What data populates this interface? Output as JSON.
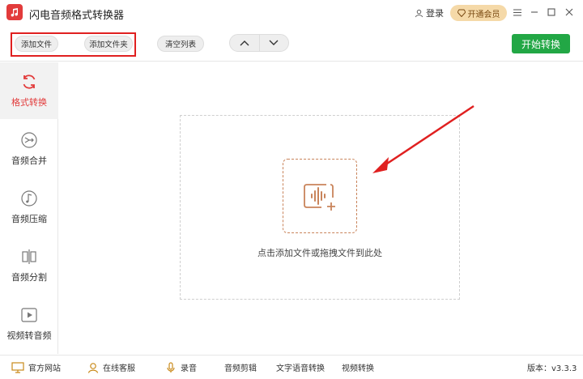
{
  "window": {
    "title": "闪电音频格式转换器",
    "login_label": "登录",
    "vip_label": "开通会员",
    "menu_icon": "hamburger-icon",
    "minimize_icon": "minimize-icon",
    "maximize_icon": "maximize-icon",
    "close_icon": "close-icon"
  },
  "toolbar": {
    "add_file": "添加文件",
    "add_folder": "添加文件夹",
    "clear_list": "清空列表",
    "start": "开始转换"
  },
  "sidebar": {
    "items": [
      {
        "label": "格式转换",
        "icon": "refresh-icon",
        "active": true
      },
      {
        "label": "音频合并",
        "icon": "merge-icon",
        "active": false
      },
      {
        "label": "音频压缩",
        "icon": "music-note-icon",
        "active": false
      },
      {
        "label": "音频分割",
        "icon": "split-icon",
        "active": false
      },
      {
        "label": "视频转音频",
        "icon": "play-icon",
        "active": false
      }
    ]
  },
  "main": {
    "drop_hint": "点击添加文件或拖拽文件到此处"
  },
  "bottom": {
    "website": "官方网站",
    "support": "在线客服",
    "record": "录音",
    "audio_edit": "音频剪辑",
    "tts": "文字语音转换",
    "video_convert": "视频转换",
    "version": "版本：v3.3.3"
  },
  "colors": {
    "accent_red": "#e23b3b",
    "start_green": "#22a745",
    "vip_gold": "#f5d9a8",
    "drop_border": "#c9845b"
  }
}
